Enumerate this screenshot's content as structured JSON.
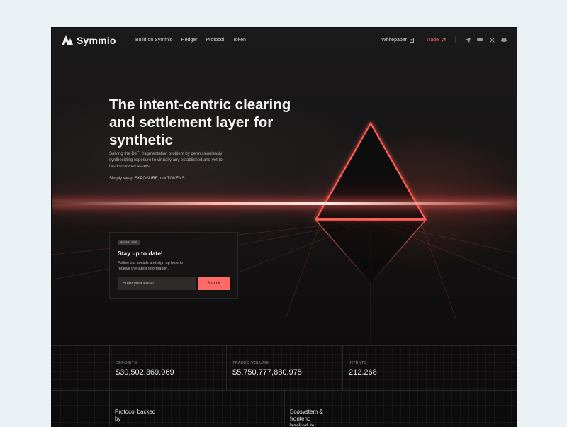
{
  "nav": {
    "logo_text": "Symmio",
    "links": [
      "Build on Symmio",
      "Hedger",
      "Protocol",
      "Token"
    ],
    "whitepaper": "Whitepaper",
    "trade": "Trade"
  },
  "hero": {
    "title": "The intent-centric clearing and settlement layer for synthetic",
    "description": "Solving the DeFi fragmentation problem by permissionlessly synthesizing exposure to virtually any established and yet-to-be-discovered assets.",
    "tagline": "Simply swap EXPOSURE, not TOKENS."
  },
  "newsletter": {
    "badge": "$SYMM TGE",
    "title": "Stay up to date!",
    "text": "Follow our socials and sign up here to receive the latest information.",
    "email_placeholder": "Enter your email",
    "submit_label": "Submit"
  },
  "stats": [
    {
      "label": "DEPOSITS",
      "value": "$30,502,369.969"
    },
    {
      "label": "TRADED VOLUME",
      "value": "$5,750,777,880.975"
    },
    {
      "label": "INTENTS",
      "value": "212.268"
    }
  ],
  "partners": {
    "protocol": "Protocol backed by",
    "ecosystem": "Ecosystem & frontend backed by"
  },
  "colors": {
    "accent": "#ff6a66",
    "background": "#141313",
    "page": "#ebf2f6"
  }
}
